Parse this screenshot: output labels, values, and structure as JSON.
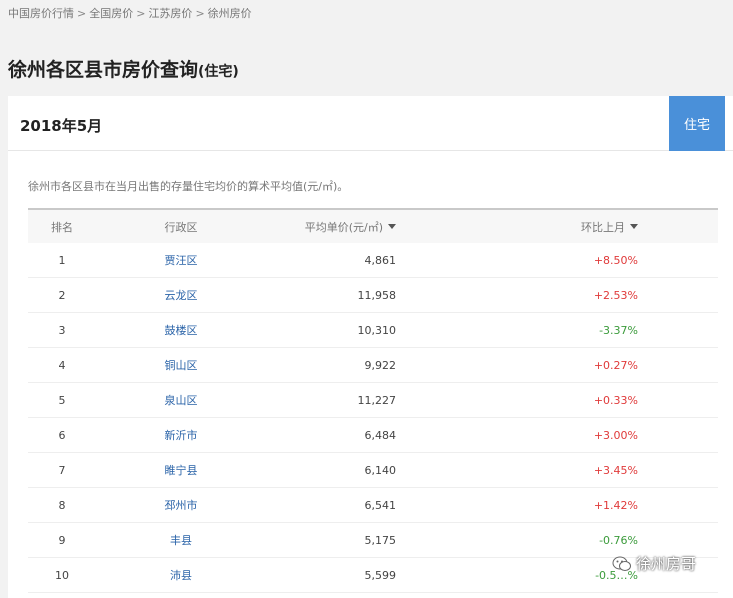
{
  "breadcrumb": [
    "中国房价行情",
    "全国房价",
    "江苏房价",
    "徐州房价"
  ],
  "breadcrumb_sep": ">",
  "title": {
    "main": "徐州各区县市房价查询",
    "sub": "(住宅)"
  },
  "month": "2018年5月",
  "type_tab": "住宅",
  "note": "徐州市各区县市在当月出售的存量住宅均价的算术平均值(元/㎡)。",
  "table": {
    "headers": {
      "rank": "排名",
      "district": "行政区",
      "price": "平均单价(元/㎡)",
      "change": "环比上月"
    },
    "rows": [
      {
        "rank": "1",
        "district": "贾汪区",
        "price": "4,861",
        "change": "+8.50%",
        "trend": "up"
      },
      {
        "rank": "2",
        "district": "云龙区",
        "price": "11,958",
        "change": "+2.53%",
        "trend": "up"
      },
      {
        "rank": "3",
        "district": "鼓楼区",
        "price": "10,310",
        "change": "-3.37%",
        "trend": "down"
      },
      {
        "rank": "4",
        "district": "铜山区",
        "price": "9,922",
        "change": "+0.27%",
        "trend": "up"
      },
      {
        "rank": "5",
        "district": "泉山区",
        "price": "11,227",
        "change": "+0.33%",
        "trend": "up"
      },
      {
        "rank": "6",
        "district": "新沂市",
        "price": "6,484",
        "change": "+3.00%",
        "trend": "up"
      },
      {
        "rank": "7",
        "district": "睢宁县",
        "price": "6,140",
        "change": "+3.45%",
        "trend": "up"
      },
      {
        "rank": "8",
        "district": "邳州市",
        "price": "6,541",
        "change": "+1.42%",
        "trend": "up"
      },
      {
        "rank": "9",
        "district": "丰县",
        "price": "5,175",
        "change": "-0.76%",
        "trend": "down"
      },
      {
        "rank": "10",
        "district": "沛县",
        "price": "5,599",
        "change": "-0.5…%",
        "trend": "down"
      }
    ]
  },
  "colors": {
    "accent": "#4a90d9",
    "up": "#e03a3a",
    "down": "#3b9b3b",
    "link": "#2a63a8"
  },
  "watermark": {
    "text": "徐州房哥",
    "icon": "wechat-icon"
  }
}
